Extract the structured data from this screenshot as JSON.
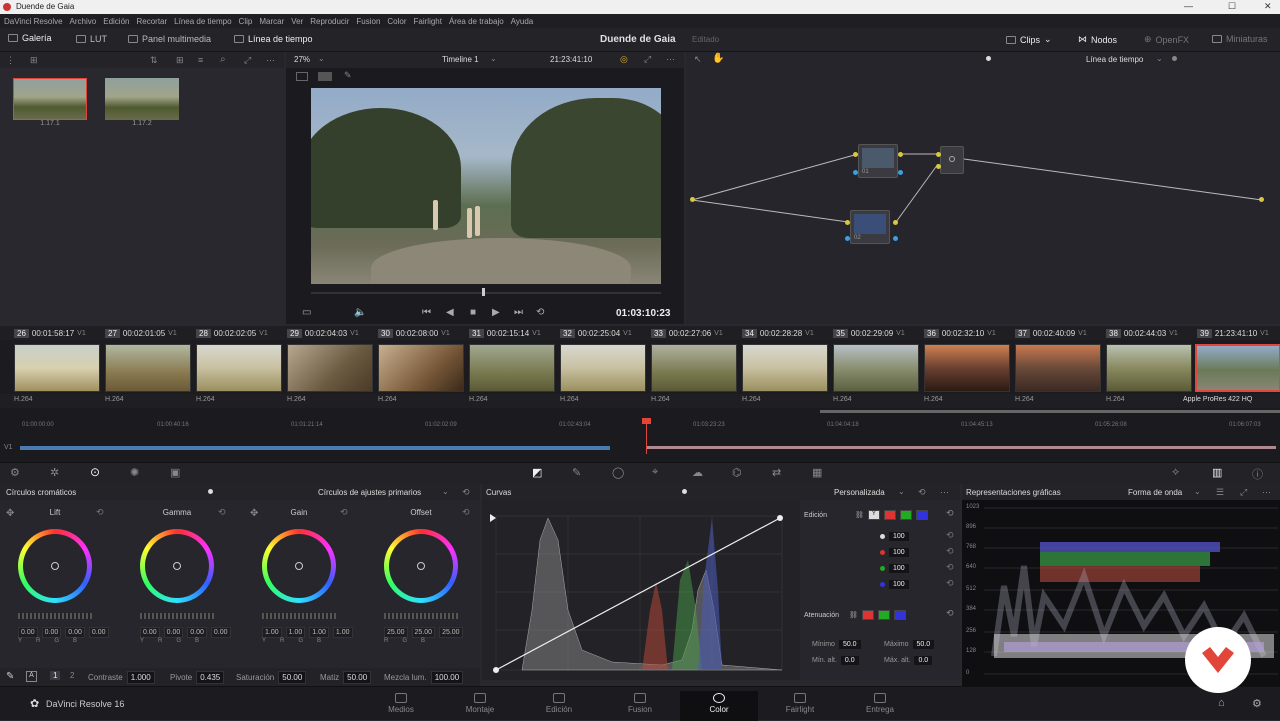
{
  "window": {
    "title": "Duende de Gaia"
  },
  "menu": [
    "DaVinci Resolve",
    "Archivo",
    "Edición",
    "Recortar",
    "Línea de tiempo",
    "Clip",
    "Marcar",
    "Ver",
    "Reproducir",
    "Fusion",
    "Color",
    "Fairlight",
    "Área de trabajo",
    "Ayuda"
  ],
  "toolbar": {
    "gallery": "Galería",
    "lut": "LUT",
    "media": "Panel multimedia",
    "timeline": "Línea de tiempo",
    "project": "Duende de Gaia",
    "status": "Editado",
    "clips": "Clips",
    "nodes": "Nodos",
    "openfx": "OpenFX",
    "thumbs": "Miniaturas"
  },
  "gallery": {
    "stills": [
      {
        "label": "1.17.1"
      },
      {
        "label": "1.17.2"
      }
    ]
  },
  "viewer": {
    "zoom": "27%",
    "timeline": "Timeline 1",
    "timecode_top": "21:23:41:10",
    "timecode": "01:03:10:23"
  },
  "node_editor": {
    "mode": "Línea de tiempo",
    "node1": "01",
    "node2": "02"
  },
  "clips": [
    {
      "num": "26",
      "tc": "00:01:58:17",
      "track": "V1",
      "codec": "H.264"
    },
    {
      "num": "27",
      "tc": "00:02:01:05",
      "track": "V1",
      "codec": "H.264"
    },
    {
      "num": "28",
      "tc": "00:02:02:05",
      "track": "V1",
      "codec": "H.264"
    },
    {
      "num": "29",
      "tc": "00:02:04:03",
      "track": "V1",
      "codec": "H.264"
    },
    {
      "num": "30",
      "tc": "00:02:08:00",
      "track": "V1",
      "codec": "H.264"
    },
    {
      "num": "31",
      "tc": "00:02:15:14",
      "track": "V1",
      "codec": "H.264"
    },
    {
      "num": "32",
      "tc": "00:02:25:04",
      "track": "V1",
      "codec": "H.264"
    },
    {
      "num": "33",
      "tc": "00:02:27:06",
      "track": "V1",
      "codec": "H.264"
    },
    {
      "num": "34",
      "tc": "00:02:28:28",
      "track": "V1",
      "codec": "H.264"
    },
    {
      "num": "35",
      "tc": "00:02:29:09",
      "track": "V1",
      "codec": "H.264"
    },
    {
      "num": "36",
      "tc": "00:02:32:10",
      "track": "V1",
      "codec": "H.264"
    },
    {
      "num": "37",
      "tc": "00:02:40:09",
      "track": "V1",
      "codec": "H.264"
    },
    {
      "num": "38",
      "tc": "00:02:44:03",
      "track": "V1",
      "codec": "H.264"
    },
    {
      "num": "39",
      "tc": "21:23:41:10",
      "track": "V1",
      "codec": "Apple ProRes 422 HQ"
    }
  ],
  "ruler": {
    "track": "V1",
    "ticks": [
      "01:00:00:00",
      "01:00:40:16",
      "01:01:21:14",
      "01:02:02:09",
      "01:02:43:04",
      "01:03:23:23",
      "01:04:04:18",
      "01:04:45:13",
      "01:05:26:08",
      "01:06:07:03"
    ]
  },
  "wheels": {
    "title": "Círculos cromáticos",
    "mode": "Círculos de ajustes primarios",
    "items": [
      {
        "label": "Lift",
        "values": [
          "0.00",
          "0.00",
          "0.00",
          "0.00"
        ]
      },
      {
        "label": "Gamma",
        "values": [
          "0.00",
          "0.00",
          "0.00",
          "0.00"
        ]
      },
      {
        "label": "Gain",
        "values": [
          "1.00",
          "1.00",
          "1.00",
          "1.00"
        ]
      },
      {
        "label": "Offset",
        "values": [
          "25.00",
          "25.00",
          "25.00"
        ]
      }
    ],
    "channels": [
      "Y",
      "R",
      "G",
      "B"
    ]
  },
  "adjust": {
    "page1": "1",
    "page2": "2",
    "contrast_label": "Contraste",
    "contrast": "1.000",
    "pivot_label": "Pivote",
    "pivot": "0.435",
    "sat_label": "Saturación",
    "sat": "50.00",
    "hue_label": "Matiz",
    "hue": "50.00",
    "lummix_label": "Mezcla lum.",
    "lummix": "100.00"
  },
  "curves": {
    "title": "Curvas",
    "mode": "Personalizada",
    "edit_label": "Edición",
    "edit_values": [
      "100",
      "100",
      "100",
      "100"
    ],
    "soft_label": "Atenuación",
    "min_label": "Mínimo",
    "min": "50.0",
    "max_label": "Máximo",
    "max": "50.0",
    "minh_label": "Mín. alt.",
    "minh": "0.0",
    "maxh_label": "Máx. alt.",
    "maxh": "0.0"
  },
  "scopes": {
    "title": "Representaciones gráficas",
    "mode": "Forma de onda",
    "scale": [
      "1023",
      "896",
      "768",
      "640",
      "512",
      "384",
      "256",
      "128",
      "0"
    ]
  },
  "pages": [
    "Medios",
    "Montaje",
    "Edición",
    "Fusion",
    "Color",
    "Fairlight",
    "Entrega"
  ],
  "app": {
    "name": "DaVinci Resolve 16"
  },
  "colors": {
    "accent": "#e2453a",
    "active_page": "#0f0f12"
  }
}
